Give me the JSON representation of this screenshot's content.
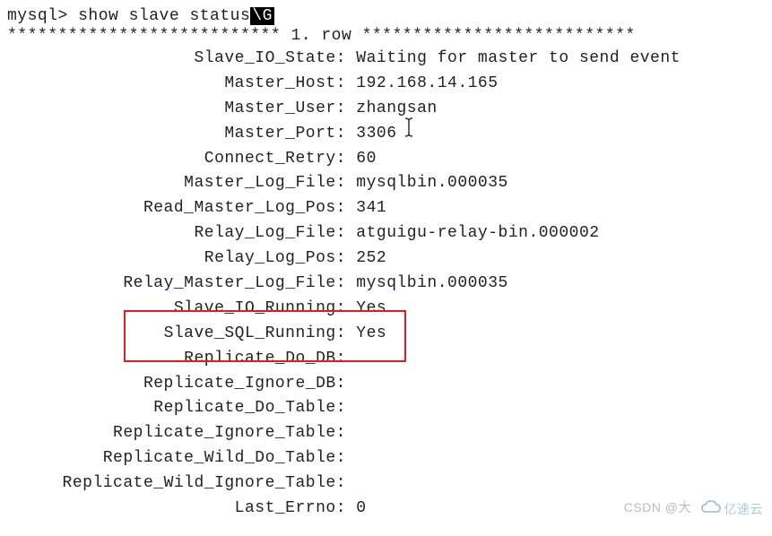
{
  "prompt": {
    "prefix": "mysql> ",
    "command": "show slave status",
    "suffix": "\\G"
  },
  "row_header": {
    "stars_left": "***************************",
    "text": " 1. row ",
    "stars_right": "***************************"
  },
  "fields": [
    {
      "label": "Slave_IO_State:",
      "value": "Waiting for master to send event"
    },
    {
      "label": "Master_Host:",
      "value": "192.168.14.165"
    },
    {
      "label": "Master_User:",
      "value": "zhangsan"
    },
    {
      "label": "Master_Port:",
      "value": "3306"
    },
    {
      "label": "Connect_Retry:",
      "value": "60"
    },
    {
      "label": "Master_Log_File:",
      "value": "mysqlbin.000035"
    },
    {
      "label": "Read_Master_Log_Pos:",
      "value": "341"
    },
    {
      "label": "Relay_Log_File:",
      "value": "atguigu-relay-bin.000002"
    },
    {
      "label": "Relay_Log_Pos:",
      "value": "252"
    },
    {
      "label": "Relay_Master_Log_File:",
      "value": "mysqlbin.000035"
    },
    {
      "label": "Slave_IO_Running:",
      "value": "Yes"
    },
    {
      "label": "Slave_SQL_Running:",
      "value": "Yes"
    },
    {
      "label": "Replicate_Do_DB:",
      "value": ""
    },
    {
      "label": "Replicate_Ignore_DB:",
      "value": ""
    },
    {
      "label": "Replicate_Do_Table:",
      "value": ""
    },
    {
      "label": "Replicate_Ignore_Table:",
      "value": ""
    },
    {
      "label": "Replicate_Wild_Do_Table:",
      "value": ""
    },
    {
      "label": "Replicate_Wild_Ignore_Table:",
      "value": ""
    },
    {
      "label": "Last_Errno:",
      "value": "0"
    }
  ],
  "watermarks": {
    "csdn": "CSDN @大",
    "logo_text": "亿速云"
  }
}
